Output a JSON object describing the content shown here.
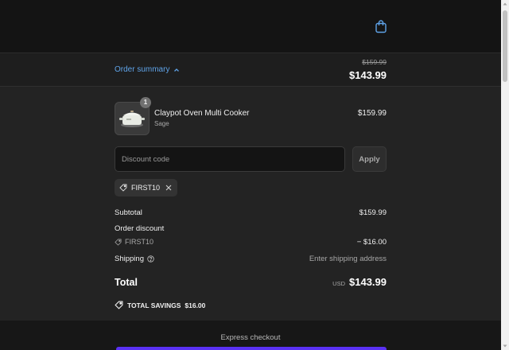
{
  "header": {
    "cart_icon": "shopping-bag-icon"
  },
  "summary_bar": {
    "toggle_label": "Order summary",
    "original_total": "$159.99",
    "total": "$143.99"
  },
  "cart": {
    "items": [
      {
        "name": "Claypot Oven Multi Cooker",
        "variant": "Sage",
        "price": "$159.99",
        "quantity": "1"
      }
    ]
  },
  "discount": {
    "placeholder": "Discount code",
    "value": "",
    "apply_label": "Apply",
    "applied_code": "FIRST10"
  },
  "totals": {
    "subtotal_label": "Subtotal",
    "subtotal_value": "$159.99",
    "order_discount_label": "Order discount",
    "discount_code": "FIRST10",
    "discount_value": "− $16.00",
    "shipping_label": "Shipping",
    "shipping_value": "Enter shipping address",
    "total_label": "Total",
    "currency": "USD",
    "total_value": "$143.99",
    "savings_label": "TOTAL SAVINGS",
    "savings_value": "$16.00"
  },
  "express": {
    "label": "Express checkout"
  },
  "colors": {
    "accent": "#5fa3e8",
    "express_button": "#5a31f4",
    "background": "#232323"
  }
}
